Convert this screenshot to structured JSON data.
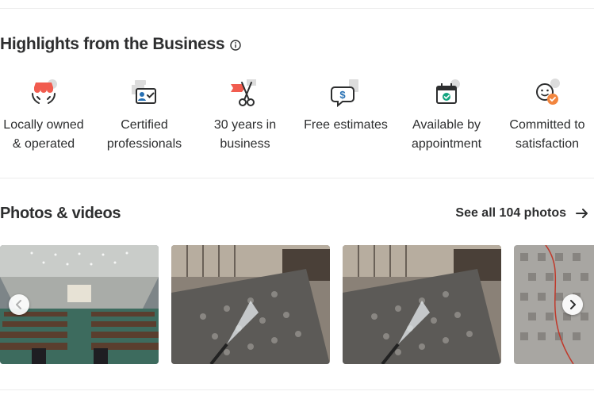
{
  "highlights": {
    "title": "Highlights from the Business",
    "items": [
      {
        "icon": "locally-owned-icon",
        "line1": "Locally owned",
        "line2": "& operated"
      },
      {
        "icon": "certified-icon",
        "line1": "Certified",
        "line2": "professionals"
      },
      {
        "icon": "years-in-business-icon",
        "line1": "30 years in",
        "line2": "business"
      },
      {
        "icon": "free-estimates-icon",
        "line1": "Free estimates",
        "line2": ""
      },
      {
        "icon": "appointment-icon",
        "line1": "Available by",
        "line2": "appointment"
      },
      {
        "icon": "satisfaction-icon",
        "line1": "Committed to",
        "line2": "satisfaction"
      }
    ]
  },
  "photos": {
    "title": "Photos & videos",
    "see_all": "See all 104 photos",
    "items": [
      {
        "description": "church-sanctuary-pews"
      },
      {
        "description": "rug-cleaning-spray"
      },
      {
        "description": "rug-cleaning-spray"
      },
      {
        "description": "patterned-rug-with-hose"
      }
    ]
  },
  "colors": {
    "text": "#2d2e2f",
    "accent_red": "#f15c4f",
    "accent_blue": "#2770b3",
    "accent_green": "#12a47f",
    "accent_orange": "#f2853e",
    "divider": "#ebebeb"
  }
}
